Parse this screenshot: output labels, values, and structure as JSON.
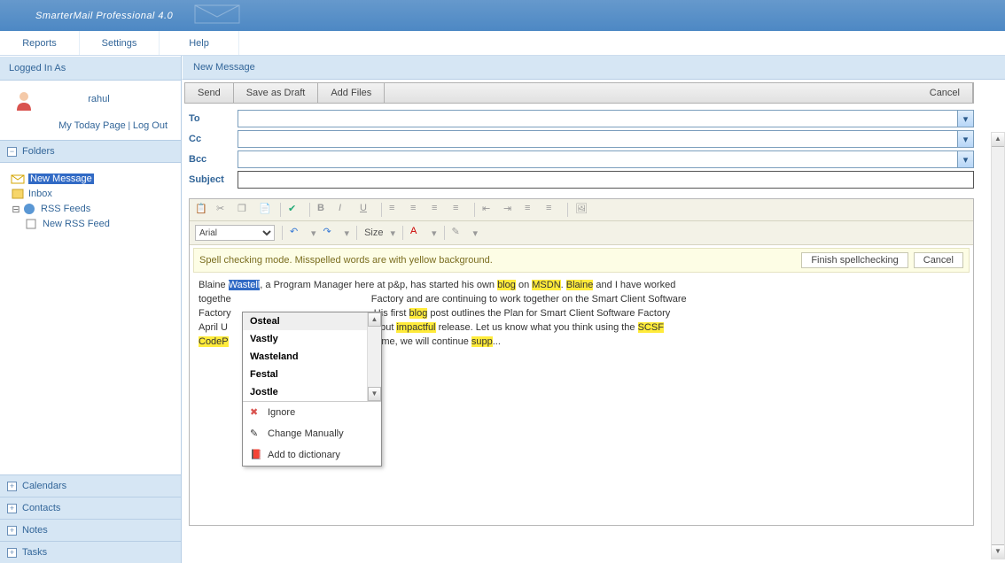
{
  "app": {
    "title": "SmarterMail Professional 4.0"
  },
  "menu": {
    "reports": "Reports",
    "settings": "Settings",
    "help": "Help"
  },
  "sidebar": {
    "logged_in_label": "Logged In As",
    "username": "rahul",
    "today_page": "My Today Page",
    "logout": "Log Out",
    "folders_label": "Folders",
    "tree": {
      "new_message": "New Message",
      "inbox": "Inbox",
      "rss_feeds": "RSS Feeds",
      "new_rss_feed": "New RSS Feed"
    },
    "nav": {
      "calendars": "Calendars",
      "contacts": "Contacts",
      "notes": "Notes",
      "tasks": "Tasks"
    }
  },
  "compose": {
    "title": "New Message",
    "toolbar": {
      "send": "Send",
      "save_draft": "Save as Draft",
      "add_files": "Add Files",
      "cancel": "Cancel"
    },
    "fields": {
      "to": "To",
      "cc": "Cc",
      "bcc": "Bcc",
      "subject": "Subject"
    }
  },
  "editor": {
    "font": "Arial",
    "size_label": "Size"
  },
  "spell": {
    "message": "Spell checking mode. Misspelled words are with yellow background.",
    "finish": "Finish spellchecking",
    "cancel": "Cancel"
  },
  "body": {
    "p1a": "Blaine ",
    "selword": "Wastell",
    "p1b": ", a Program Manager here at p&p, has started his own ",
    "hl_blog": "blog",
    "p1c": " on ",
    "hl_msdn": "MSDN",
    "p1d": ". ",
    "hl_blaine": "Blaine",
    "p1e": " and I have worked",
    "p2": "togethe",
    "p2b": " Factory and are continuing to work together on the Smart Client Software",
    "p3": "Factory",
    "p3b": ". His first ",
    "hl_blog2": "blog",
    "p3c": " post outlines the Plan for Smart Client Software Factory",
    "p4": "April U",
    "p4b": "all, but ",
    "hl_impactful": "impactful",
    "p4c": " release. Let us know what you think using the ",
    "hl_scsf": "SCSF",
    "p5a": "CodeP",
    "p5b": "antime, we will continue ",
    "hl_supp": "supp",
    "p5c": "..."
  },
  "suggest": {
    "opts": [
      "Osteal",
      "Vastly",
      "Wasteland",
      "Festal",
      "Jostle"
    ],
    "ignore": "Ignore",
    "change": "Change Manually",
    "add": "Add to dictionary"
  }
}
